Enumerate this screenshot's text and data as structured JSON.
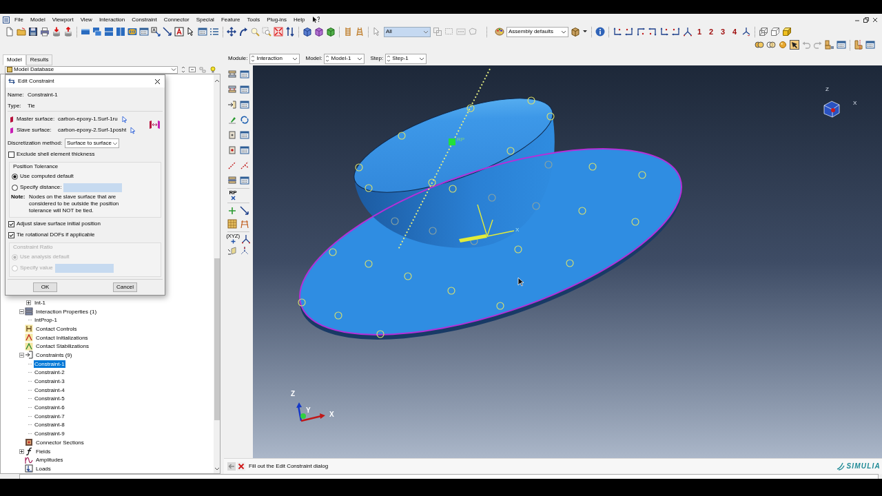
{
  "menu": [
    "File",
    "Model",
    "Viewport",
    "View",
    "Interaction",
    "Constraint",
    "Connector",
    "Special",
    "Feature",
    "Tools",
    "Plug-ins",
    "Help"
  ],
  "toolbar": {
    "selection_filter": "All",
    "render_style": "Assembly defaults",
    "view_numbers": [
      "1",
      "2",
      "3",
      "4"
    ]
  },
  "tabs": [
    {
      "label": "Model",
      "selected": true
    },
    {
      "label": "Results",
      "selected": false
    }
  ],
  "context_bar": [
    {
      "label": "Module:",
      "value": "Interaction"
    },
    {
      "label": "Model:",
      "value": "Model-1"
    },
    {
      "label": "Step:",
      "value": "Step-1"
    }
  ],
  "model_tree": {
    "source": "Model Database",
    "items": [
      {
        "children": [
          {
            "label": "Int-1",
            "expanded": false,
            "selected": false
          }
        ]
      },
      {
        "label": "Interaction Properties (1)",
        "expanded": true,
        "selected": false,
        "children": [
          {
            "label": "IntProp-1",
            "selected": false
          }
        ]
      },
      {
        "label": "Contact Controls",
        "selected": false
      },
      {
        "label": "Contact Initializations",
        "selected": false
      },
      {
        "label": "Contact Stabilizations",
        "selected": false
      },
      {
        "label": "Constraints (9)",
        "expanded": true,
        "selected": false,
        "children": [
          {
            "label": "Constraint-1",
            "selected": true
          },
          {
            "label": "Constraint-2",
            "selected": false
          },
          {
            "label": "Constraint-3",
            "selected": false
          },
          {
            "label": "Constraint-4",
            "selected": false
          },
          {
            "label": "Constraint-5",
            "selected": false
          },
          {
            "label": "Constraint-6",
            "selected": false
          },
          {
            "label": "Constraint-7",
            "selected": false
          },
          {
            "label": "Constraint-8",
            "selected": false
          },
          {
            "label": "Constraint-9",
            "selected": false
          }
        ]
      },
      {
        "label": "Connector Sections",
        "selected": false
      },
      {
        "label": "Fields",
        "expanded": false,
        "selected": false
      },
      {
        "label": "Amplitudes",
        "selected": false
      },
      {
        "label": "Loads",
        "selected": false
      }
    ]
  },
  "toolbox_labels": [
    "RP",
    "(XYZ)"
  ],
  "dialog": {
    "title": "Edit Constraint",
    "name_label": "Name:",
    "name": "Constraint-1",
    "type_label": "Type:",
    "type": "Tie",
    "surfaces": [
      {
        "label": "Master surface:",
        "value": "carbon-epoxy-1.Surf-1ru",
        "color": "#b8123e"
      },
      {
        "label": "Slave surface:",
        "value": "carbon-epoxy-2.Surf-1posht",
        "color": "#c81fb5"
      }
    ],
    "discretization": {
      "label": "Discretization method:",
      "value": "Surface to surface"
    },
    "exclude_shell_thickness": {
      "label": "Exclude shell element thickness",
      "checked": false
    },
    "position_tolerance": {
      "title": "Position Tolerance",
      "disabled": false,
      "options": [
        {
          "label": "Use computed default",
          "selected": true,
          "kind": "plain"
        },
        {
          "label": "Specify distance:",
          "selected": false,
          "kind": "field"
        }
      ],
      "note_label": "Note:",
      "note": "Nodes on the slave surface that are considered to be outside the position tolerance will NOT be tied."
    },
    "options": [
      {
        "label": "Adjust slave surface initial position",
        "checked": true
      },
      {
        "label": "Tie rotational DOFs if applicable",
        "checked": true
      }
    ],
    "constraint_ratio": {
      "title": "Constraint Ratio",
      "disabled": true,
      "options": [
        {
          "label": "Use analysis default",
          "selected": true,
          "kind": "plain"
        },
        {
          "label": "Specify value",
          "selected": false,
          "kind": "field"
        }
      ]
    },
    "buttons": [
      "OK",
      "Cancel"
    ]
  },
  "viewport": {
    "point_label": "RP",
    "axis_label": "X",
    "view_cube_labels": [
      "Z",
      "X"
    ],
    "triad_labels": [
      "Z",
      "Y",
      "X"
    ]
  },
  "prompt": "Fill out the Edit Constraint dialog",
  "brand": "SIMULIA"
}
